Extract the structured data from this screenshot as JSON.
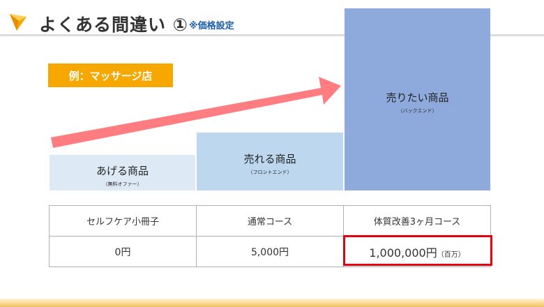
{
  "header": {
    "title": "よくある間違い ①",
    "subtitle": "※価格設定"
  },
  "example_label": "例：マッサージ店",
  "steps": [
    {
      "name": "あげる商品",
      "sub": "（無料オファー）"
    },
    {
      "name": "売れる商品",
      "sub": "（フロントエンド）"
    },
    {
      "name": "売りたい商品",
      "sub": "（バックエンド）"
    }
  ],
  "table": {
    "products": [
      "セルフケア小冊子",
      "通常コース",
      "体質改善3ヶ月コース"
    ],
    "prices": [
      "0円",
      "5,000円",
      "1,000,000円"
    ],
    "price_note": "（百万）"
  },
  "colors": {
    "accent_orange": "#f7a800",
    "arrow": "#ff7c80",
    "highlight": "#e3000f",
    "step_light": "#dde9f5",
    "step_mid": "#bdd7ee",
    "step_dark": "#8eaadc",
    "subtitle_blue": "#1f5fa8"
  },
  "icons": {
    "logo": "orange-triangle-logo-icon"
  }
}
